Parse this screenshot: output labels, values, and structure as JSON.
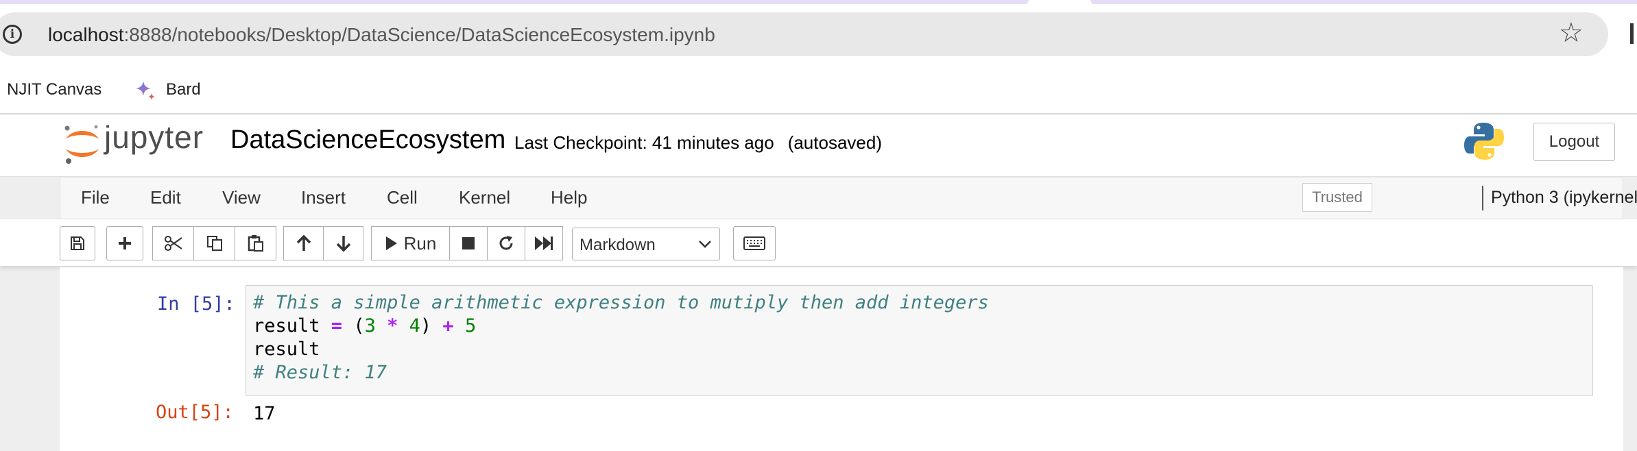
{
  "browser": {
    "url_host": "localhost",
    "url_rest": ":8888/notebooks/Desktop/DataScience/DataScienceEcosystem.ipynb",
    "bookmarks": [
      {
        "label": "NJIT Canvas"
      },
      {
        "label": "Bard",
        "icon": "bard-sparkle-icon"
      }
    ]
  },
  "header": {
    "logo_text": "jupyter",
    "notebook_name": "DataScienceEcosystem",
    "checkpoint": "Last Checkpoint: 41 minutes ago",
    "autosaved": "(autosaved)",
    "logout_label": "Logout"
  },
  "menu": {
    "items": [
      "File",
      "Edit",
      "View",
      "Insert",
      "Cell",
      "Kernel",
      "Help"
    ],
    "trusted_label": "Trusted",
    "kernel_name": "Python 3 (ipykernel)"
  },
  "toolbar": {
    "run_label": "Run",
    "cell_type": "Markdown",
    "icons": [
      "save-icon",
      "plus-icon",
      "cut-icon",
      "copy-icon",
      "paste-icon",
      "arrow-up-icon",
      "arrow-down-icon",
      "run-icon",
      "stop-icon",
      "restart-icon",
      "fast-forward-icon",
      "keyboard-icon"
    ]
  },
  "cell": {
    "in_prompt": "In [5]:",
    "out_prompt": "Out[5]:",
    "comment1": "# This a simple arithmetic expression to mutiply then add integers",
    "line2": {
      "a": "result ",
      "eq": "=",
      "b": " (",
      "n1": "3",
      "c": " ",
      "mul": "*",
      "d": " ",
      "n2": "4",
      "e": ") ",
      "plus": "+",
      "f": " ",
      "n3": "5"
    },
    "line3": "result",
    "comment2": "# Result: 17",
    "output": "17"
  },
  "colors": {
    "accent_orange": "#f37726",
    "prompt_in": "#303f9f",
    "prompt_out": "#d84315",
    "comment": "#408080",
    "operator": "#aa22ff",
    "number": "#008000"
  }
}
